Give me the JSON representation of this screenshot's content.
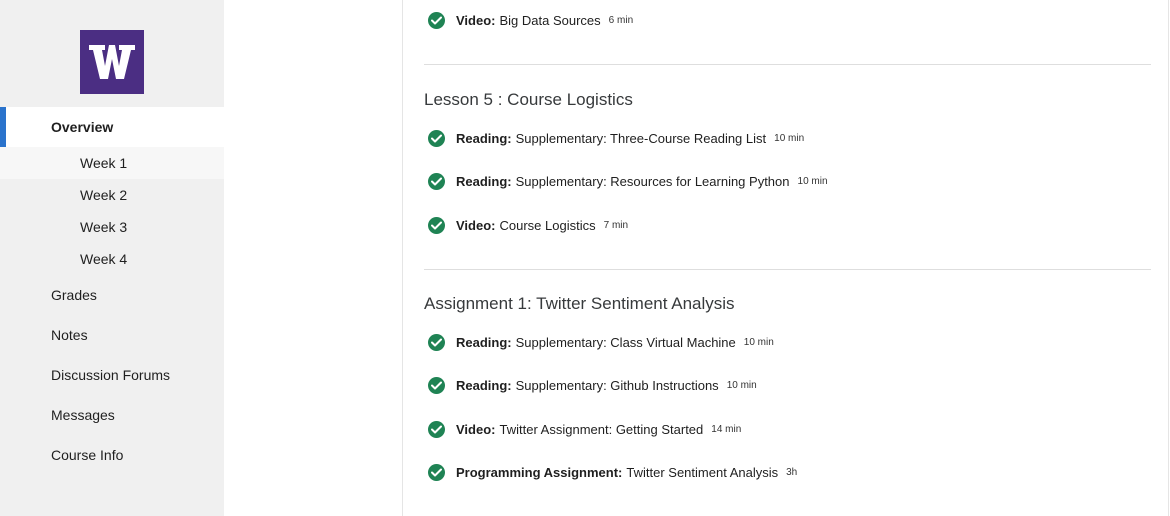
{
  "sidebar": {
    "logo_letter": "W",
    "items": [
      {
        "label": "Overview"
      },
      {
        "label": "Grades"
      },
      {
        "label": "Notes"
      },
      {
        "label": "Discussion Forums"
      },
      {
        "label": "Messages"
      },
      {
        "label": "Course Info"
      }
    ],
    "weeks": [
      {
        "label": "Week 1"
      },
      {
        "label": "Week 2"
      },
      {
        "label": "Week 3"
      },
      {
        "label": "Week 4"
      }
    ]
  },
  "content": {
    "top_item": {
      "type": "Video:",
      "title": "Big Data Sources",
      "duration": "6 min"
    },
    "lesson5": {
      "title": "Lesson 5 : Course Logistics",
      "items": [
        {
          "type": "Reading:",
          "title": "Supplementary: Three-Course Reading List",
          "duration": "10 min"
        },
        {
          "type": "Reading:",
          "title": "Supplementary: Resources for Learning Python",
          "duration": "10 min"
        },
        {
          "type": "Video:",
          "title": "Course Logistics",
          "duration": "7 min"
        }
      ]
    },
    "assignment1": {
      "title": "Assignment 1: Twitter Sentiment Analysis",
      "items": [
        {
          "type": "Reading:",
          "title": "Supplementary: Class Virtual Machine",
          "duration": "10 min"
        },
        {
          "type": "Reading:",
          "title": "Supplementary: Github Instructions",
          "duration": "10 min"
        },
        {
          "type": "Video:",
          "title": "Twitter Assignment: Getting Started",
          "duration": "14 min"
        },
        {
          "type": "Programming Assignment:",
          "title": "Twitter Sentiment Analysis",
          "duration": "3h"
        }
      ]
    }
  },
  "colors": {
    "brand": "#4b2e83",
    "accent": "#2a73cc",
    "check": "#1f8354"
  },
  "icons": {
    "completed": "check-circle-icon"
  }
}
